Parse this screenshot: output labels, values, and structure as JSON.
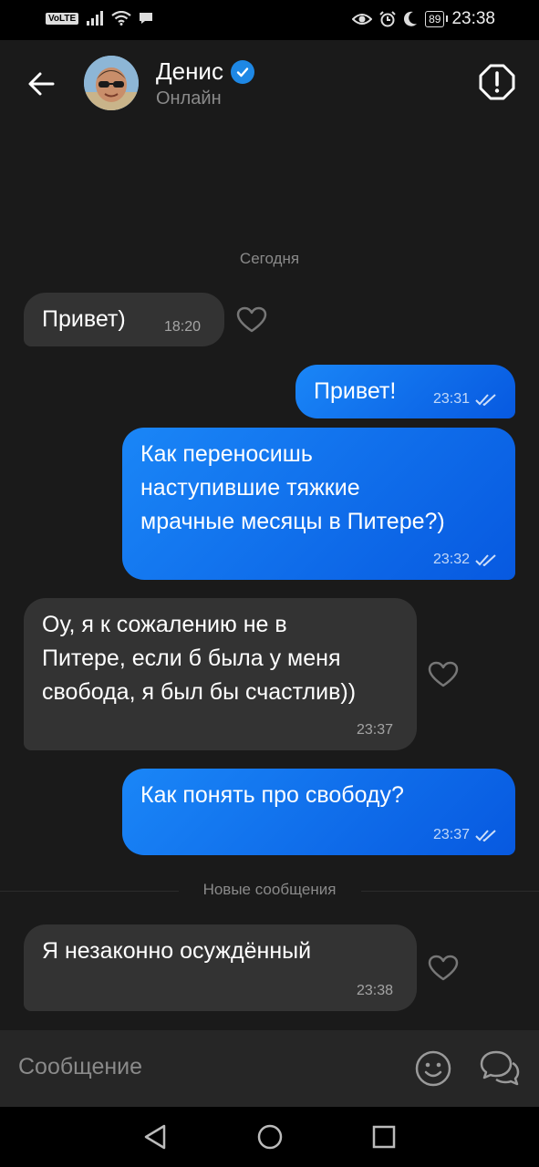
{
  "status_bar": {
    "network": "VoLTE",
    "battery": "89",
    "time": "23:38"
  },
  "header": {
    "name": "Денис",
    "status": "Онлайн"
  },
  "date_separator": "Сегодня",
  "messages": [
    {
      "direction": "in",
      "text": "Привет)",
      "time": "18:20"
    },
    {
      "direction": "out",
      "text": "Привет!",
      "time": "23:31"
    },
    {
      "direction": "out",
      "text": "Как переносишь\nнаступившие тяжкие\nмрачные месяцы в Питере?)",
      "time": "23:32"
    },
    {
      "direction": "in",
      "text": "Оу, я к сожалению не в\nПитере, если б была у меня\nсвобода, я был бы счастлив))",
      "time": "23:37"
    },
    {
      "direction": "out",
      "text": "Как понять про свободу?",
      "time": "23:37"
    },
    {
      "direction": "in",
      "text": "Я незаконно осуждённый",
      "time": "23:38"
    }
  ],
  "new_messages_separator": "Новые сообщения",
  "composer": {
    "placeholder": "Сообщение"
  },
  "colors": {
    "accent": "#1a86f7",
    "incoming_bubble": "#333333",
    "background": "#1a1a1a"
  }
}
